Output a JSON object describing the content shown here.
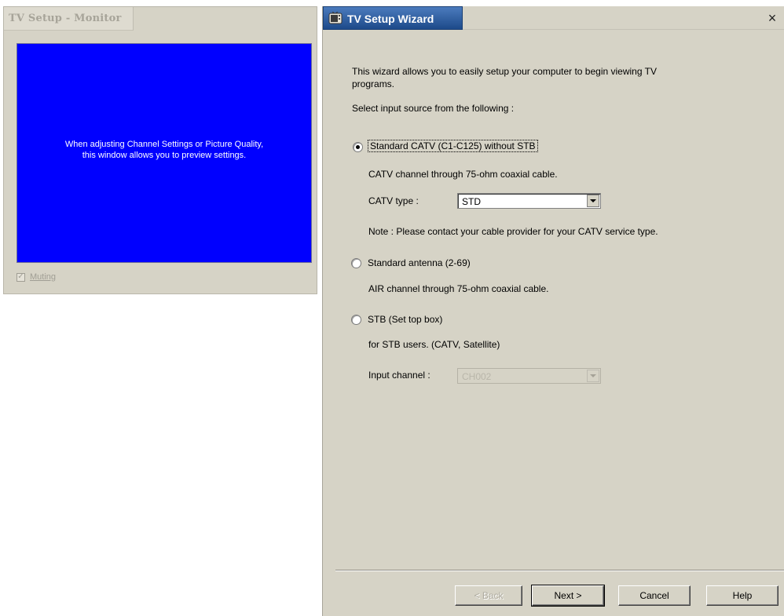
{
  "monitor": {
    "title": "TV Setup - Monitor",
    "preview_line1": "When adjusting Channel Settings or Picture Quality,",
    "preview_line2": "this window allows you to preview settings.",
    "muting_label": "Muting",
    "muting_checked": true
  },
  "wizard": {
    "title": "TV Setup Wizard",
    "intro_line1": "This wizard allows you to easily setup your computer to begin viewing TV",
    "intro_line2": "programs.",
    "select_prompt": "Select input source from the following :",
    "options": [
      {
        "label": "Standard CATV (C1-C125) without STB",
        "desc": "CATV channel through 75-ohm coaxial cable.",
        "selected": true
      },
      {
        "label": "Standard antenna (2-69)",
        "desc": "AIR channel through 75-ohm coaxial cable.",
        "selected": false
      },
      {
        "label": "STB (Set top box)",
        "desc": "for STB users. (CATV, Satellite)",
        "selected": false
      }
    ],
    "catv_type_label": "CATV type :",
    "catv_type_value": "STD",
    "note": "Note : Please contact your cable provider for your CATV service type.",
    "input_channel_label": "Input channel :",
    "input_channel_value": "CH002",
    "buttons": {
      "back": "< Back",
      "next": "Next >",
      "cancel": "Cancel",
      "help": "Help"
    },
    "close_glyph": "×"
  }
}
